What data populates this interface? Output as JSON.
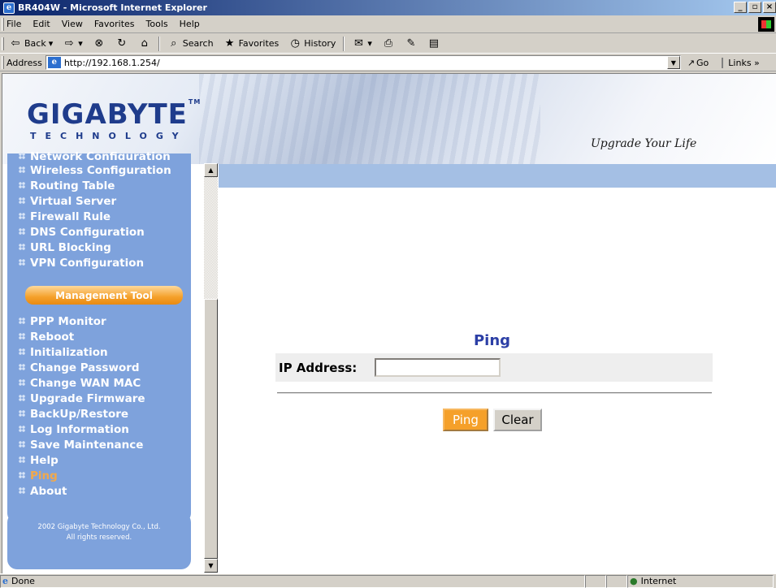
{
  "window": {
    "title": "BR404W - Microsoft Internet Explorer"
  },
  "menu": [
    "File",
    "Edit",
    "View",
    "Favorites",
    "Tools",
    "Help"
  ],
  "toolbar": {
    "back": "Back",
    "search": "Search",
    "favorites": "Favorites",
    "history": "History"
  },
  "address": {
    "label": "Address",
    "url": "http://192.168.1.254/",
    "go": "Go",
    "links": "Links"
  },
  "banner": {
    "logo": "GIGABYTE",
    "logo_sub": "TECHNOLOGY",
    "tagline": "Upgrade Your Life"
  },
  "sidebar": {
    "items_top": [
      "Network Configuration",
      "Wireless Configuration",
      "Routing Table",
      "Virtual Server",
      "Firewall Rule",
      "DNS Configuration",
      "URL Blocking",
      "VPN Configuration"
    ],
    "management_header": "Management Tool",
    "items_bottom": [
      "PPP Monitor",
      "Reboot",
      "Initialization",
      "Change Password",
      "Change WAN MAC",
      "Upgrade Firmware",
      "BackUp/Restore",
      "Log Information",
      "Save Maintenance",
      "Help",
      "Ping",
      "About"
    ],
    "active": "Ping",
    "copyright_line1": "2002 Gigabyte Technology Co., Ltd.",
    "copyright_line2": "All rights reserved."
  },
  "ping": {
    "title": "Ping",
    "ip_label": "IP Address:",
    "ip_value": "",
    "ping_button": "Ping",
    "clear_button": "Clear"
  },
  "status": {
    "left": "Done",
    "zone": "Internet"
  }
}
